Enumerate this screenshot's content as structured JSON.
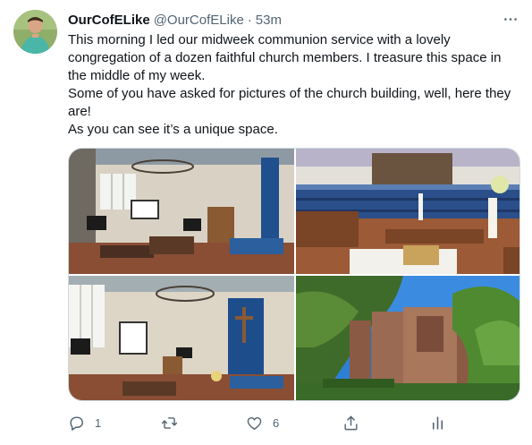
{
  "tweet": {
    "author": {
      "display_name": "OurCofELike",
      "handle": "@OurCofELike",
      "separator": "·",
      "time": "53m",
      "avatar_icon": "profile-photo"
    },
    "more_icon": "more-dots-icon",
    "paragraphs": [
      "This morning I led our midweek communion service with a lovely congregation of a dozen faithful church members. I treasure this space in the middle of my week.",
      "Some of you have asked for pictures of the church building, well, here they are!",
      "As you can see it’s a unique space."
    ],
    "photos": [
      {
        "subject": "church interior with altar and projector screen"
      },
      {
        "subject": "church interior with blue chairs and altar table"
      },
      {
        "subject": "church interior with cross and blue curtain"
      },
      {
        "subject": "church exterior brick building with trees"
      }
    ],
    "actions": {
      "reply": {
        "icon": "reply-icon",
        "count": "1"
      },
      "retweet": {
        "icon": "retweet-icon",
        "count": ""
      },
      "like": {
        "icon": "heart-icon",
        "count": "6"
      },
      "share": {
        "icon": "share-icon"
      },
      "analytics": {
        "icon": "analytics-icon"
      }
    },
    "colors": {
      "text": "#0f1419",
      "secondary": "#536471",
      "border": "#cfd9de"
    }
  }
}
